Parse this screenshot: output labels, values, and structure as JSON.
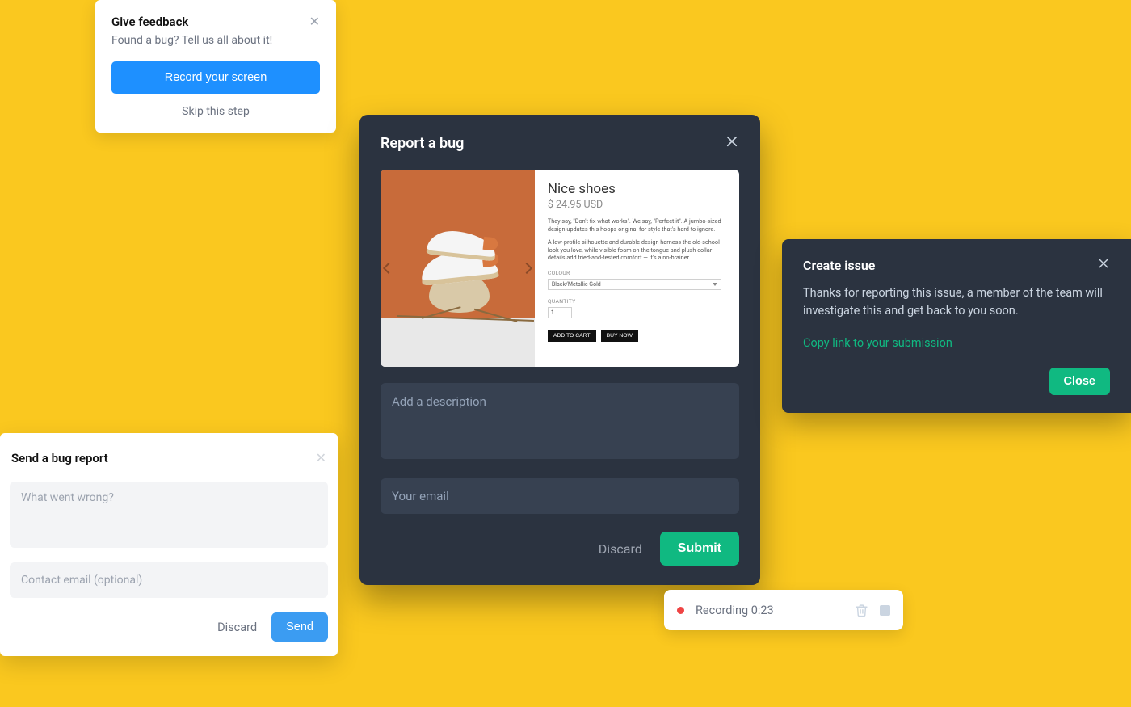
{
  "feedback": {
    "title": "Give feedback",
    "subtitle": "Found a bug? Tell us all about it!",
    "record_button": "Record your screen",
    "skip_link": "Skip this step"
  },
  "send_bug_report": {
    "title": "Send a bug report",
    "description_placeholder": "What went wrong?",
    "email_placeholder": "Contact email (optional)",
    "discard": "Discard",
    "send": "Send"
  },
  "report_bug": {
    "title": "Report a bug",
    "description_placeholder": "Add a description",
    "email_placeholder": "Your email",
    "discard": "Discard",
    "submit": "Submit",
    "product": {
      "name": "Nice shoes",
      "price": "$ 24.95 USD",
      "desc1": "They say, \"Don't fix what works\". We say, \"Perfect it\". A jumbo-sized design updates this hoops original for style that's hard to ignore.",
      "desc2": "A low-profile silhouette and durable design harness the old-school look you love, while visible foam on the tongue and plush collar details add tried-and-tested comfort — it's a no-brainer.",
      "colour_label": "COLOUR",
      "colour_value": "Black/Metallic Gold",
      "quantity_label": "QUANTITY",
      "quantity_value": "1",
      "add_to_cart": "ADD TO CART",
      "buy_now": "BUY NOW"
    }
  },
  "create_issue": {
    "title": "Create issue",
    "message": "Thanks for reporting this issue, a member of the team will investigate this and get back to you soon.",
    "copy_link": "Copy link to your submission",
    "close": "Close"
  },
  "recording": {
    "label": "Recording 0:23"
  }
}
